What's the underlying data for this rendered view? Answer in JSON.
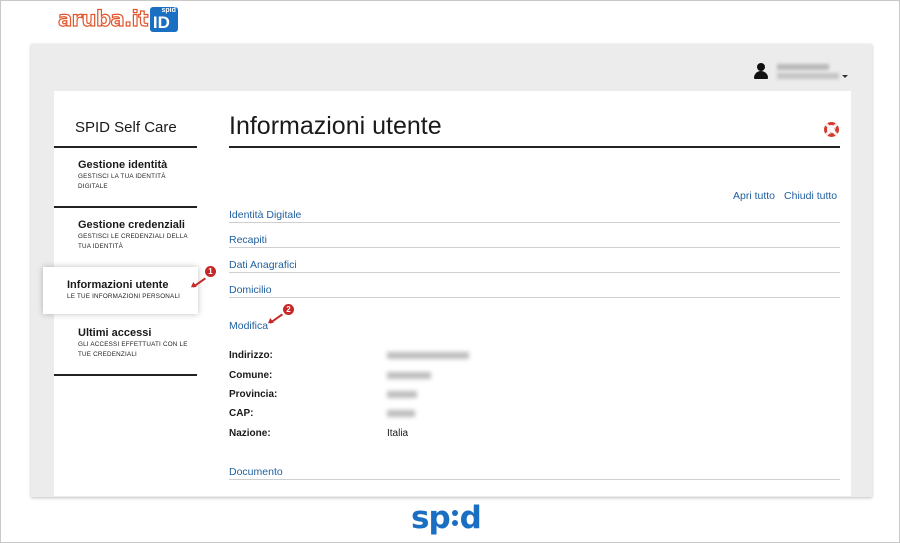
{
  "brand": {
    "name": "aruba.it",
    "badge_small": "spid",
    "badge_big": "ID"
  },
  "sidebar": {
    "title": "SPID Self Care",
    "items": [
      {
        "label": "Gestione identità",
        "desc": "Gestisci la tua identità digitale"
      },
      {
        "label": "Gestione credenziali",
        "desc": "Gestisci le credenziali della tua identità"
      },
      {
        "label": "Informazioni utente",
        "desc": "Le tue informazioni personali"
      },
      {
        "label": "Ultimi accessi",
        "desc": "Gli accessi effettuati con le tue credenziali"
      }
    ]
  },
  "main": {
    "title": "Informazioni utente",
    "open_all": "Apri tutto",
    "close_all": "Chiudi tutto",
    "sections": [
      "Identità Digitale",
      "Recapiti",
      "Dati Anagrafici",
      "Domicilio"
    ],
    "edit_link": "Modifica",
    "fields": [
      {
        "label": "Indirizzo:",
        "value": ""
      },
      {
        "label": "Comune:",
        "value": ""
      },
      {
        "label": "Provincia:",
        "value": ""
      },
      {
        "label": "CAP:",
        "value": ""
      },
      {
        "label": "Nazione:",
        "value": "Italia"
      }
    ],
    "document_section": "Documento"
  },
  "annotations": {
    "marker_1": "1",
    "marker_2": "2"
  },
  "footer_logo": {
    "left": "sp",
    "right": "d"
  },
  "colors": {
    "link": "#1f5f9e",
    "accent_red": "#c62828",
    "spid_blue": "#1a6fc2",
    "window_gray": "#ececec"
  }
}
